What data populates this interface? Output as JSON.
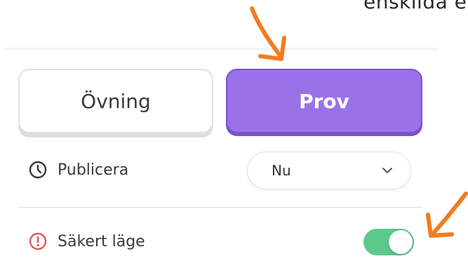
{
  "header": {
    "partial_text": "enskilda e"
  },
  "mode_switch": {
    "practice_label": "Övning",
    "test_label": "Prov",
    "selected": "Prov",
    "selected_color": "#9a72e8"
  },
  "publish": {
    "label": "Publicera",
    "icon": "clock-icon",
    "value": "Nu"
  },
  "safe_mode": {
    "label": "Säkert läge",
    "icon": "alert-circle-icon",
    "enabled": true,
    "toggle_color": "#5cc98a",
    "icon_color": "#e05a5a"
  },
  "annotations": {
    "arrow_color": "#f07c20"
  }
}
